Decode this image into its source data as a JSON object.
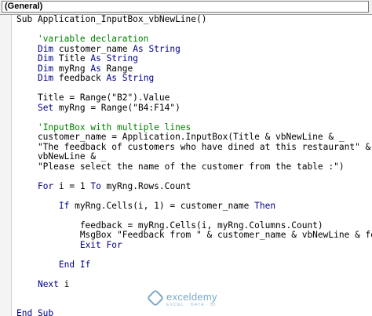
{
  "object_dropdown": {
    "value": "(General)"
  },
  "code_lines": [
    [
      {
        "t": "Sub Application_InputBox_vbNewLine()"
      }
    ],
    [],
    [
      {
        "t": "    "
      },
      {
        "t": "'variable declaration",
        "c": "cm"
      }
    ],
    [
      {
        "t": "    "
      },
      {
        "t": "Dim",
        "c": "kw"
      },
      {
        "t": " customer_name "
      },
      {
        "t": "As",
        "c": "kw"
      },
      {
        "t": " "
      },
      {
        "t": "String",
        "c": "kw"
      }
    ],
    [
      {
        "t": "    "
      },
      {
        "t": "Dim",
        "c": "kw"
      },
      {
        "t": " Title "
      },
      {
        "t": "As",
        "c": "kw"
      },
      {
        "t": " "
      },
      {
        "t": "String",
        "c": "kw"
      }
    ],
    [
      {
        "t": "    "
      },
      {
        "t": "Dim",
        "c": "kw"
      },
      {
        "t": " myRng "
      },
      {
        "t": "As",
        "c": "kw"
      },
      {
        "t": " Range"
      }
    ],
    [
      {
        "t": "    "
      },
      {
        "t": "Dim",
        "c": "kw"
      },
      {
        "t": " feedback "
      },
      {
        "t": "As",
        "c": "kw"
      },
      {
        "t": " "
      },
      {
        "t": "String",
        "c": "kw"
      }
    ],
    [],
    [
      {
        "t": "    Title = Range(\"B2\").Value"
      }
    ],
    [
      {
        "t": "    "
      },
      {
        "t": "Set",
        "c": "kw"
      },
      {
        "t": " myRng = Range(\"B4:F14\")"
      }
    ],
    [],
    [
      {
        "t": "    "
      },
      {
        "t": "'InputBox with multiple lines",
        "c": "cm"
      }
    ],
    [
      {
        "t": "    customer_name = Application.InputBox(Title & vbNewLine & _"
      }
    ],
    [
      {
        "t": "    \"The feedback of customers who have dined at this restaurant\" & _"
      }
    ],
    [
      {
        "t": "    vbNewLine & _"
      }
    ],
    [
      {
        "t": "    \"Please select the name of the customer from the table :\")"
      }
    ],
    [],
    [
      {
        "t": "    "
      },
      {
        "t": "For",
        "c": "kw"
      },
      {
        "t": " i = 1 "
      },
      {
        "t": "To",
        "c": "kw"
      },
      {
        "t": " myRng.Rows.Count"
      }
    ],
    [],
    [
      {
        "t": "        "
      },
      {
        "t": "If",
        "c": "kw"
      },
      {
        "t": " myRng.Cells(i, 1) = customer_name "
      },
      {
        "t": "Then",
        "c": "kw"
      }
    ],
    [],
    [
      {
        "t": "            feedback = myRng.Cells(i, myRng.Columns.Count)"
      }
    ],
    [
      {
        "t": "            MsgBox \"Feedback from \" & customer_name & vbNewLine & feedback"
      }
    ],
    [
      {
        "t": "            "
      },
      {
        "t": "Exit For",
        "c": "kw"
      }
    ],
    [],
    [
      {
        "t": "        "
      },
      {
        "t": "End If",
        "c": "kw"
      }
    ],
    [],
    [
      {
        "t": "    "
      },
      {
        "t": "Next",
        "c": "kw"
      },
      {
        "t": " i"
      }
    ],
    [],
    [],
    [
      {
        "t": "End Sub",
        "c": "kw"
      }
    ]
  ],
  "colors": {
    "keyword": "#00008b",
    "comment": "#008000",
    "text": "#000000",
    "watermark": "#7aa9c7"
  },
  "watermark": {
    "name": "exceldemy",
    "tagline": "EXCEL · DATA · BI"
  }
}
